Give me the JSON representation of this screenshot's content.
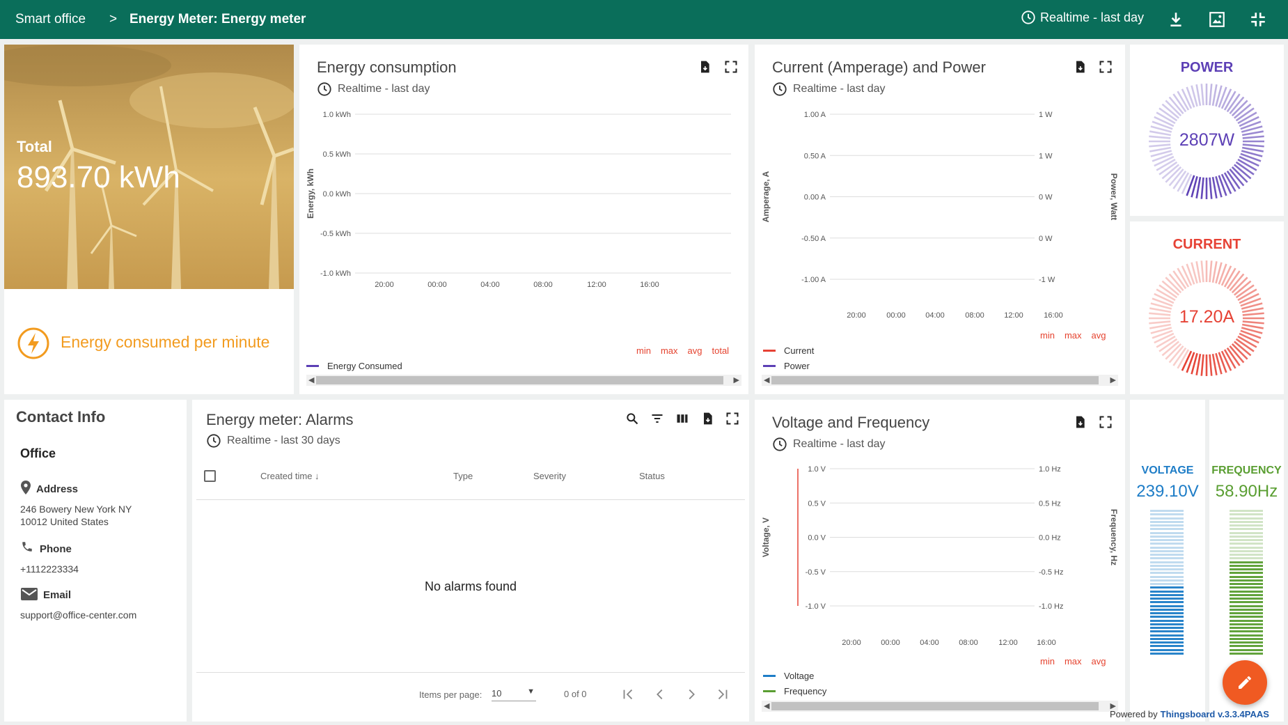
{
  "topbar": {
    "crumb_root": "Smart office",
    "crumb_sep": ">",
    "crumb_current": "Energy Meter: Energy meter",
    "timewindow": "Realtime - last day"
  },
  "total_card": {
    "title": "Total",
    "value": "893.70 kWh",
    "caption": "Energy consumed per minute"
  },
  "energy_chart": {
    "title": "Energy consumption",
    "timewindow": "Realtime - last day",
    "legend": [
      "Energy Consumed"
    ],
    "stats": [
      "min",
      "max",
      "avg",
      "total"
    ]
  },
  "amp_chart": {
    "title": "Current (Amperage) and Power",
    "timewindow": "Realtime - last day",
    "legend": [
      "Current",
      "Power"
    ],
    "stats": [
      "min",
      "max",
      "avg"
    ]
  },
  "volt_chart": {
    "title": "Voltage and Frequency",
    "timewindow": "Realtime - last day",
    "legend": [
      "Voltage",
      "Frequency"
    ],
    "stats": [
      "min",
      "max",
      "avg"
    ]
  },
  "power_gauge": {
    "title": "POWER",
    "value": "2807W",
    "level": 0.56
  },
  "current_gauge": {
    "title": "CURRENT",
    "value": "17.20A",
    "level": 0.57
  },
  "voltage_bar": {
    "title": "VOLTAGE",
    "value": "239.10V",
    "level": 0.46
  },
  "frequency_bar": {
    "title": "FREQUENCY",
    "value": "58.90Hz",
    "level": 0.64
  },
  "contact": {
    "title": "Contact Info",
    "office_label": "Office",
    "address_label": "Address",
    "address_line1": "246 Bowery New York NY",
    "address_line2": "10012 United States",
    "phone_label": "Phone",
    "phone": "+1112223334",
    "email_label": "Email",
    "email": "support@office-center.com"
  },
  "alarms": {
    "title": "Energy meter: Alarms",
    "timewindow": "Realtime - last 30 days",
    "columns": [
      "Created time",
      "Type",
      "Severity",
      "Status"
    ],
    "empty": "No alarms found",
    "items_per_page_label": "Items per page:",
    "items_per_page": "10",
    "range": "0 of 0"
  },
  "footer": {
    "powered_by": "Powered by",
    "brand": "Thingsboard v.3.3.4PAAS"
  },
  "colors": {
    "header": "#0a6e5a",
    "power": "#5c3fb5",
    "current": "#e64235",
    "voltage": "#1e7dc7",
    "frequency": "#5a9e32",
    "accent": "#f29b1f",
    "fab": "#f05a22"
  },
  "chart_data": [
    {
      "type": "line",
      "title": "Energy consumption",
      "ylabel": "Energy, kWh",
      "x_ticks": [
        "20:00",
        "00:00",
        "04:00",
        "08:00",
        "12:00",
        "16:00"
      ],
      "y_ticks": [
        "1.0 kWh",
        "0.5 kWh",
        "0.0 kWh",
        "-0.5 kWh",
        "-1.0 kWh"
      ],
      "series": [
        {
          "name": "Energy Consumed",
          "values": []
        }
      ],
      "grid": true,
      "legend_position": "bottom"
    },
    {
      "type": "line",
      "title": "Current (Amperage) and Power",
      "ylabel": "Amperage, A",
      "y2label": "Power, Watt",
      "x_ticks": [
        "20:00",
        "00:00",
        "04:00",
        "08:00",
        "12:00",
        "16:00"
      ],
      "y_ticks": [
        "1.00 A",
        "0.50 A",
        "0.00 A",
        "-0.50 A",
        "-1.00 A"
      ],
      "y2_ticks": [
        "1 W",
        "1 W",
        "0 W",
        "0 W",
        "-1 W"
      ],
      "series": [
        {
          "name": "Current",
          "values": []
        },
        {
          "name": "Power",
          "values": []
        }
      ],
      "grid": true,
      "legend_position": "bottom"
    },
    {
      "type": "line",
      "title": "Voltage and Frequency",
      "ylabel": "Voltage, V",
      "y2label": "Frequency, Hz",
      "x_ticks": [
        "20:00",
        "00:00",
        "04:00",
        "08:00",
        "12:00",
        "16:00"
      ],
      "y_ticks": [
        "1.0 V",
        "0.5 V",
        "0.0 V",
        "-0.5 V",
        "-1.0 V"
      ],
      "y2_ticks": [
        "1.0 Hz",
        "0.5 Hz",
        "0.0 Hz",
        "-0.5 Hz",
        "-1.0 Hz"
      ],
      "series": [
        {
          "name": "Voltage",
          "values": []
        },
        {
          "name": "Frequency",
          "values": []
        }
      ],
      "grid": true,
      "legend_position": "bottom"
    }
  ]
}
